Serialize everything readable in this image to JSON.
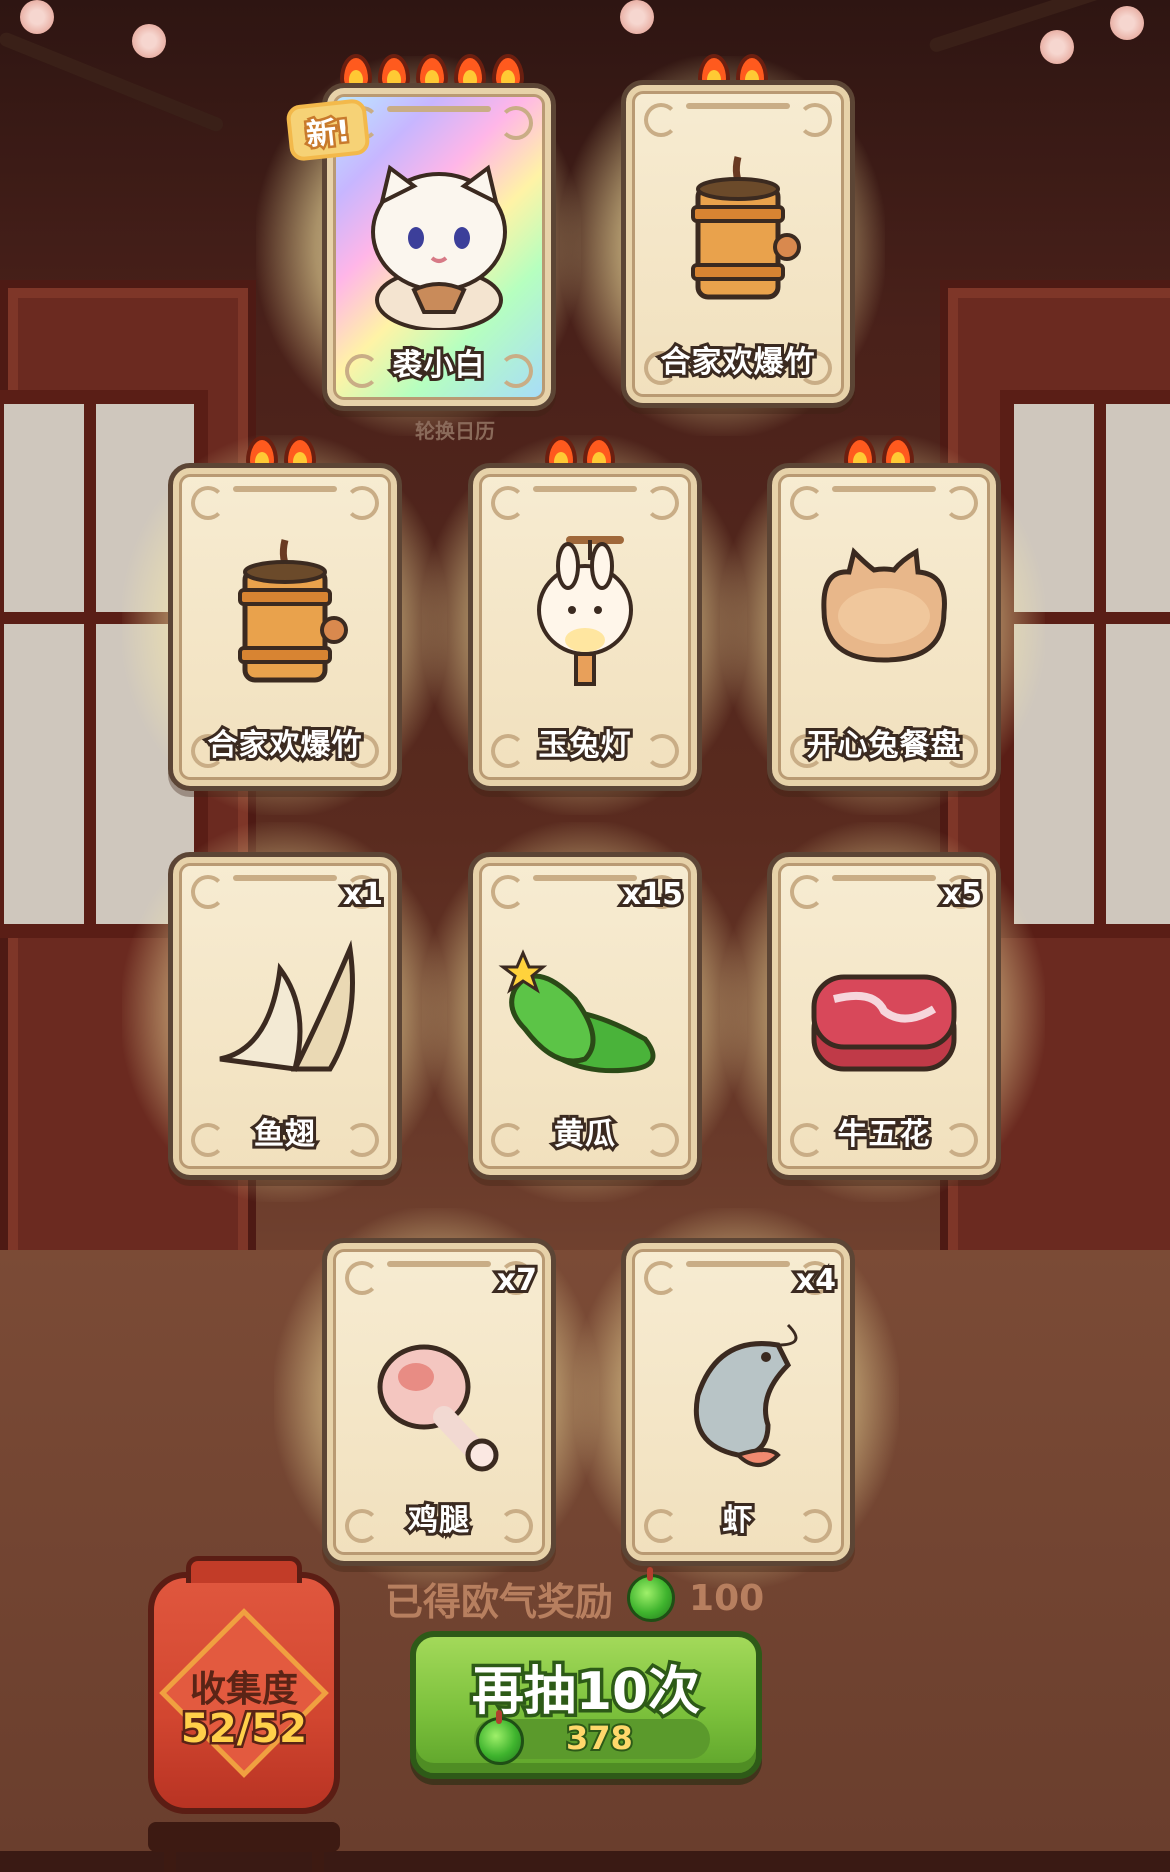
{
  "new_badge": "新!",
  "calendar_label": "轮换日历",
  "cards": [
    {
      "name": "裘小白",
      "flames": 5,
      "count": "",
      "rarity": "legendary",
      "icon": "white-cat-icon",
      "is_new": true
    },
    {
      "name": "合家欢爆竹",
      "flames": 2,
      "count": "",
      "rarity": "rare",
      "icon": "firecracker-icon"
    },
    {
      "name": "合家欢爆竹",
      "flames": 2,
      "count": "",
      "rarity": "rare",
      "icon": "firecracker-icon"
    },
    {
      "name": "玉兔灯",
      "flames": 2,
      "count": "",
      "rarity": "rare",
      "icon": "rabbit-lantern-icon"
    },
    {
      "name": "开心兔餐盘",
      "flames": 2,
      "count": "",
      "rarity": "rare",
      "icon": "rabbit-plate-icon"
    },
    {
      "name": "鱼翅",
      "flames": 0,
      "count": "x1",
      "rarity": "common",
      "icon": "shark-fin-icon"
    },
    {
      "name": "黄瓜",
      "flames": 0,
      "count": "x15",
      "rarity": "common",
      "icon": "cucumber-icon"
    },
    {
      "name": "牛五花",
      "flames": 0,
      "count": "x5",
      "rarity": "common",
      "icon": "beef-slice-icon"
    },
    {
      "name": "鸡腿",
      "flames": 0,
      "count": "x7",
      "rarity": "common",
      "icon": "chicken-leg-icon"
    },
    {
      "name": "虾",
      "flames": 0,
      "count": "x4",
      "rarity": "common",
      "icon": "shrimp-icon"
    }
  ],
  "reward": {
    "label": "已得欧气奖励",
    "amount": "100",
    "icon": "green-coin-icon"
  },
  "collection": {
    "label": "收集度",
    "value": "52/52"
  },
  "draw_button": {
    "label": "再抽10次",
    "cost": "378"
  },
  "colors": {
    "card_bg": "#f4e6c6",
    "card_border": "#5c4535",
    "button_green": "#7cc13c",
    "lantern_red": "#d24630",
    "glow": "#fff6c8"
  }
}
